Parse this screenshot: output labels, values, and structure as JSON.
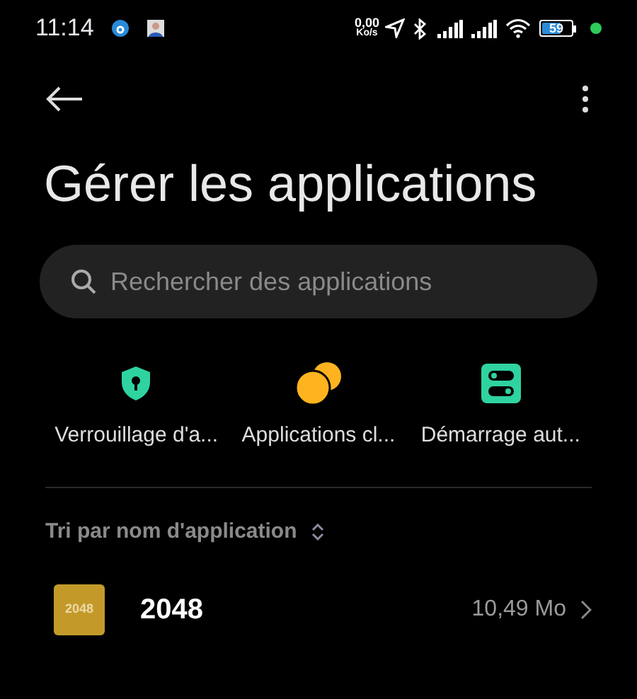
{
  "status_bar": {
    "time": "11:14",
    "net_speed": "0,00",
    "net_unit": "Ko/s",
    "battery": "59"
  },
  "header": {
    "title": "Gérer les applications"
  },
  "search": {
    "placeholder": "Rechercher des applications"
  },
  "shortcuts": [
    {
      "kind": "lock",
      "label": "Verrouillage d'a..."
    },
    {
      "kind": "cleaner",
      "label": "Applications cl..."
    },
    {
      "kind": "autostart",
      "label": "Démarrage aut..."
    }
  ],
  "sort": {
    "label": "Tri par nom d'application"
  },
  "apps": [
    {
      "icon_text": "2048",
      "name": "2048",
      "size": "10,49 Mo"
    }
  ]
}
